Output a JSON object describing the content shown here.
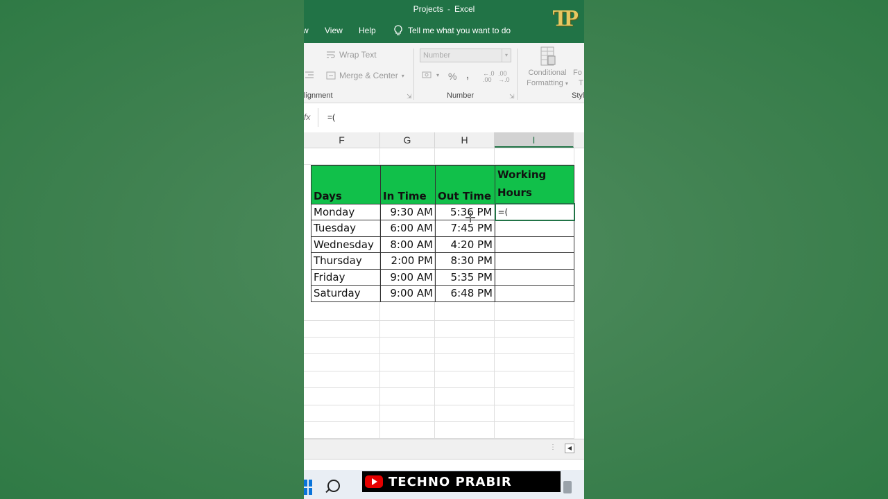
{
  "window": {
    "file_name": "Projects",
    "separator": "-",
    "app_name": "Excel",
    "logo_text": "TP"
  },
  "tabs": [
    {
      "label": "w"
    },
    {
      "label": "View"
    },
    {
      "label": "Help"
    }
  ],
  "tell_me": "Tell me what you want to do",
  "ribbon": {
    "wrap_text": "Wrap Text",
    "merge_center": "Merge & Center",
    "alignment_label": "lignment",
    "number_format": "Number",
    "percent": "%",
    "comma": ",",
    "inc_decimal": "←.0\n.00",
    "dec_decimal": ".00\n→.0",
    "number_label": "Number",
    "conditional": "Conditional",
    "formatting": "Formatting",
    "format_as_1": "Fo",
    "format_as_2": "T",
    "styles_label": "Styl"
  },
  "formula_bar": {
    "fx": "fx",
    "value": "=("
  },
  "columns": [
    "F",
    "G",
    "H",
    "I"
  ],
  "table": {
    "headers": [
      "Days",
      "In Time",
      "Out Time",
      "Working Hours"
    ],
    "rows": [
      [
        "Monday",
        "9:30 AM",
        "5:36 PM",
        "=("
      ],
      [
        "Tuesday",
        "6:00 AM",
        "7:45 PM",
        ""
      ],
      [
        "Wednesday",
        "8:00 AM",
        "4:20 PM",
        ""
      ],
      [
        "Thursday",
        "2:00 PM",
        "8:30 PM",
        ""
      ],
      [
        "Friday",
        "9:00 AM",
        "5:35 PM",
        ""
      ],
      [
        "Saturday",
        "9:00 AM",
        "6:48 PM",
        ""
      ]
    ]
  },
  "watermark": "TECHNO PRABIR",
  "colors": {
    "excel_green": "#217346",
    "header_fill": "#11c04a",
    "logo_gold": "#e8c760"
  }
}
